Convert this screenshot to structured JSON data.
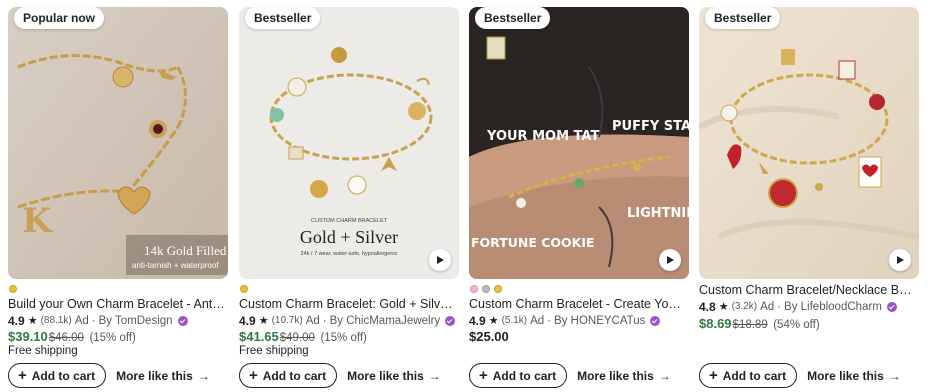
{
  "colors": {
    "price_sale": "#2f7a3e",
    "star_seller": "#9b53c7",
    "text": "#222222",
    "muted": "#595959"
  },
  "listings": [
    {
      "badge": "Popular now",
      "image_overlay": {
        "line1": "14k Gold Filled",
        "line2": "anti-tarnish + waterproof"
      },
      "swatches": [
        "#e9c234"
      ],
      "title": "Build your Own Charm Bracelet - Anti-Tarnish, Waterproof Gold Filled",
      "rating": "4.9",
      "review_count": "(88.1k)",
      "ad_label": "Ad",
      "seller": "By TomDesign",
      "price": "$39.10",
      "original_price": "$46.00",
      "discount": "(15% off)",
      "shipping": "Free shipping",
      "add_to_cart": "Add to cart",
      "more_like_this": "More like this"
    },
    {
      "badge": "Bestseller",
      "image_overlay": {
        "caption": "CUSTOM CHARM BRACELET",
        "headline": "Gold + Silver",
        "subline": "24k / 7 wear, water-safe, hypoallergenic"
      },
      "swatches": [
        "#e9c234"
      ],
      "title": "Custom Charm Bracelet: Gold + Silver, Waterproof Jewelry",
      "rating": "4.9",
      "review_count": "(10.7k)",
      "ad_label": "Ad",
      "seller": "By ChicMamaJewelry",
      "price": "$41.65",
      "original_price": "$49.00",
      "discount": "(15% off)",
      "shipping": "Free shipping",
      "add_to_cart": "Add to cart",
      "more_like_this": "More like this"
    },
    {
      "badge": "Bestseller",
      "image_overlay": {
        "label1": "YOUR MOM TAT",
        "label2": "PUFFY STAR",
        "label3": "LIGHTNING",
        "label4": "FORTUNE COOKIE"
      },
      "swatches": [
        "#f4b6c2",
        "#b9b9b9",
        "#e9c234"
      ],
      "title": "Custom Charm Bracelet - Create Your Own Dainty Charm Bracelet",
      "rating": "4.9",
      "review_count": "(5.1k)",
      "ad_label": "Ad",
      "seller": "By HONEYCATus",
      "price": "$25.00",
      "original_price": "",
      "discount": "",
      "shipping": "",
      "add_to_cart": "Add to cart",
      "more_like_this": "More like this"
    },
    {
      "badge": "Bestseller",
      "swatches": [],
      "title": "Custom Charm Bracelet/Necklace Build Your Own Charm Jewelry",
      "rating": "4.8",
      "review_count": "(3.2k)",
      "ad_label": "Ad",
      "seller": "By LifebloodCharm",
      "price": "$8.69",
      "original_price": "$18.89",
      "discount": "(54% off)",
      "shipping": "",
      "add_to_cart": "Add to cart",
      "more_like_this": "More like this"
    }
  ]
}
